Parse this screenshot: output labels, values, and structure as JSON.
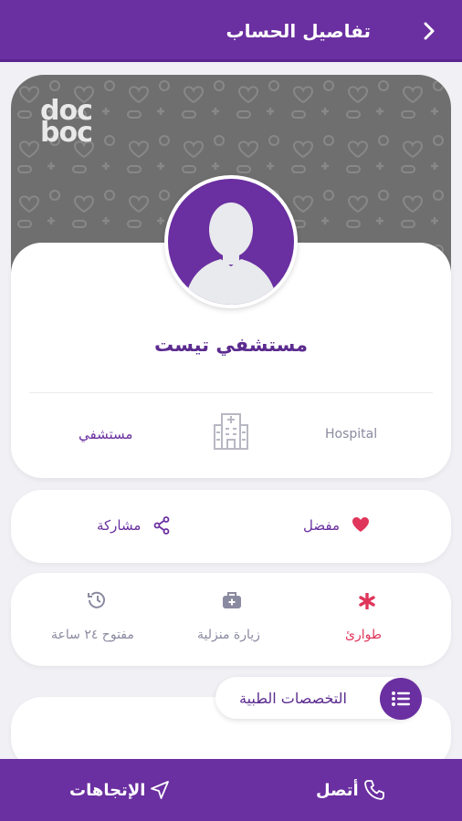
{
  "header": {
    "title": "تفاصيل الحساب",
    "back_icon": "chevron-right-icon"
  },
  "hero": {
    "logo_line1": "doc",
    "logo_line2": "boc"
  },
  "profile": {
    "name": "مستشفي تيست",
    "type_en": "Hospital",
    "type_ar": "مستشفي"
  },
  "actions": {
    "favorite_label": "مفضل",
    "share_label": "مشاركة"
  },
  "options": {
    "emergency_label": "طوارئ",
    "home_visit_label": "زيارة منزلية",
    "open24_label": "مفتوح ٢٤ ساعة"
  },
  "specialties": {
    "label": "التخصصات الطبية"
  },
  "bottom": {
    "call_label": "أتصل",
    "directions_label": "الإتجاهات"
  },
  "colors": {
    "primary": "#6a2fa0",
    "emergency": "#e0365b",
    "heart": "#e0365b"
  }
}
